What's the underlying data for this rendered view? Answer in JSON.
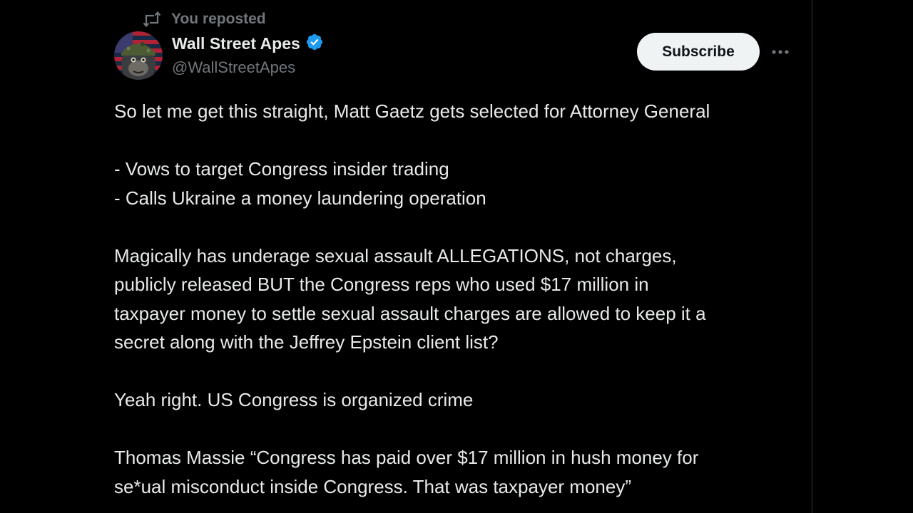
{
  "repost": {
    "icon": "repost-icon",
    "text": "You reposted"
  },
  "author": {
    "avatar": "gorilla-soldier-avatar",
    "display_name": "Wall Street Apes",
    "verified_icon": "verified-badge-icon",
    "verified_color": "#1d9bf0",
    "handle": "@WallStreetApes"
  },
  "actions": {
    "subscribe_label": "Subscribe",
    "more_icon": "more-horizontal-icon"
  },
  "tweet": {
    "lines": [
      "So let me get this straight, Matt Gaetz gets selected for Attorney General",
      "",
      "- Vows to target Congress insider trading",
      "- Calls Ukraine a money laundering operation",
      "",
      "Magically has underage sexual assault ALLEGATIONS, not charges,",
      "publicly released BUT the Congress reps who used $17 million in",
      "taxpayer money to settle sexual assault charges are allowed to keep it a",
      "secret along with the Jeffrey Epstein client list?",
      "",
      "Yeah right. US Congress is organized crime",
      "",
      "Thomas Massie “Congress has paid over $17 million in hush money for",
      "se*ual misconduct inside Congress. That was taxpayer money”"
    ]
  },
  "colors": {
    "background": "#000000",
    "text": "#e7e9ea",
    "secondary_text": "#71767b",
    "subscribe_bg": "#eff3f4",
    "subscribe_text": "#0f1419",
    "border": "#2f3336"
  }
}
